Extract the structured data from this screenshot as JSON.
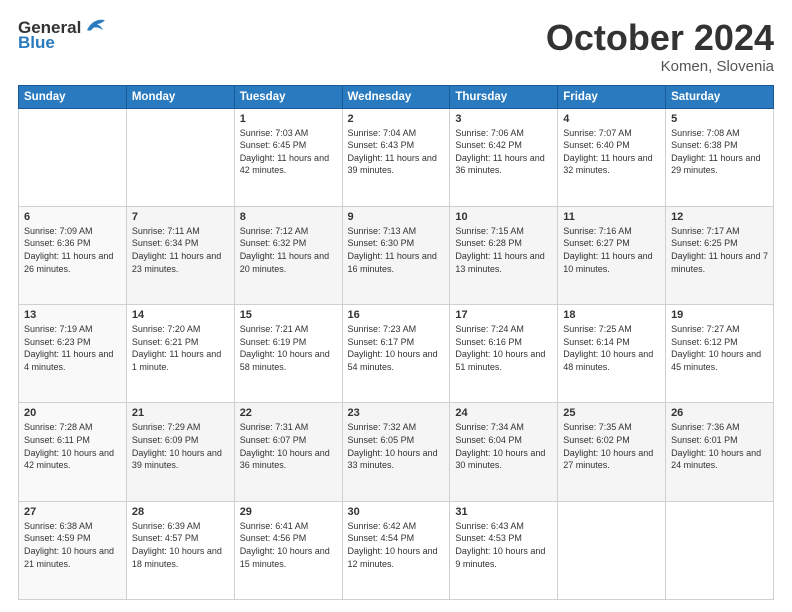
{
  "header": {
    "logo_text1": "General",
    "logo_text2": "Blue",
    "title": "October 2024",
    "location": "Komen, Slovenia"
  },
  "weekdays": [
    "Sunday",
    "Monday",
    "Tuesday",
    "Wednesday",
    "Thursday",
    "Friday",
    "Saturday"
  ],
  "weeks": [
    [
      {
        "day": "",
        "content": ""
      },
      {
        "day": "",
        "content": ""
      },
      {
        "day": "1",
        "content": "Sunrise: 7:03 AM\nSunset: 6:45 PM\nDaylight: 11 hours and 42 minutes."
      },
      {
        "day": "2",
        "content": "Sunrise: 7:04 AM\nSunset: 6:43 PM\nDaylight: 11 hours and 39 minutes."
      },
      {
        "day": "3",
        "content": "Sunrise: 7:06 AM\nSunset: 6:42 PM\nDaylight: 11 hours and 36 minutes."
      },
      {
        "day": "4",
        "content": "Sunrise: 7:07 AM\nSunset: 6:40 PM\nDaylight: 11 hours and 32 minutes."
      },
      {
        "day": "5",
        "content": "Sunrise: 7:08 AM\nSunset: 6:38 PM\nDaylight: 11 hours and 29 minutes."
      }
    ],
    [
      {
        "day": "6",
        "content": "Sunrise: 7:09 AM\nSunset: 6:36 PM\nDaylight: 11 hours and 26 minutes."
      },
      {
        "day": "7",
        "content": "Sunrise: 7:11 AM\nSunset: 6:34 PM\nDaylight: 11 hours and 23 minutes."
      },
      {
        "day": "8",
        "content": "Sunrise: 7:12 AM\nSunset: 6:32 PM\nDaylight: 11 hours and 20 minutes."
      },
      {
        "day": "9",
        "content": "Sunrise: 7:13 AM\nSunset: 6:30 PM\nDaylight: 11 hours and 16 minutes."
      },
      {
        "day": "10",
        "content": "Sunrise: 7:15 AM\nSunset: 6:28 PM\nDaylight: 11 hours and 13 minutes."
      },
      {
        "day": "11",
        "content": "Sunrise: 7:16 AM\nSunset: 6:27 PM\nDaylight: 11 hours and 10 minutes."
      },
      {
        "day": "12",
        "content": "Sunrise: 7:17 AM\nSunset: 6:25 PM\nDaylight: 11 hours and 7 minutes."
      }
    ],
    [
      {
        "day": "13",
        "content": "Sunrise: 7:19 AM\nSunset: 6:23 PM\nDaylight: 11 hours and 4 minutes."
      },
      {
        "day": "14",
        "content": "Sunrise: 7:20 AM\nSunset: 6:21 PM\nDaylight: 11 hours and 1 minute."
      },
      {
        "day": "15",
        "content": "Sunrise: 7:21 AM\nSunset: 6:19 PM\nDaylight: 10 hours and 58 minutes."
      },
      {
        "day": "16",
        "content": "Sunrise: 7:23 AM\nSunset: 6:17 PM\nDaylight: 10 hours and 54 minutes."
      },
      {
        "day": "17",
        "content": "Sunrise: 7:24 AM\nSunset: 6:16 PM\nDaylight: 10 hours and 51 minutes."
      },
      {
        "day": "18",
        "content": "Sunrise: 7:25 AM\nSunset: 6:14 PM\nDaylight: 10 hours and 48 minutes."
      },
      {
        "day": "19",
        "content": "Sunrise: 7:27 AM\nSunset: 6:12 PM\nDaylight: 10 hours and 45 minutes."
      }
    ],
    [
      {
        "day": "20",
        "content": "Sunrise: 7:28 AM\nSunset: 6:11 PM\nDaylight: 10 hours and 42 minutes."
      },
      {
        "day": "21",
        "content": "Sunrise: 7:29 AM\nSunset: 6:09 PM\nDaylight: 10 hours and 39 minutes."
      },
      {
        "day": "22",
        "content": "Sunrise: 7:31 AM\nSunset: 6:07 PM\nDaylight: 10 hours and 36 minutes."
      },
      {
        "day": "23",
        "content": "Sunrise: 7:32 AM\nSunset: 6:05 PM\nDaylight: 10 hours and 33 minutes."
      },
      {
        "day": "24",
        "content": "Sunrise: 7:34 AM\nSunset: 6:04 PM\nDaylight: 10 hours and 30 minutes."
      },
      {
        "day": "25",
        "content": "Sunrise: 7:35 AM\nSunset: 6:02 PM\nDaylight: 10 hours and 27 minutes."
      },
      {
        "day": "26",
        "content": "Sunrise: 7:36 AM\nSunset: 6:01 PM\nDaylight: 10 hours and 24 minutes."
      }
    ],
    [
      {
        "day": "27",
        "content": "Sunrise: 6:38 AM\nSunset: 4:59 PM\nDaylight: 10 hours and 21 minutes."
      },
      {
        "day": "28",
        "content": "Sunrise: 6:39 AM\nSunset: 4:57 PM\nDaylight: 10 hours and 18 minutes."
      },
      {
        "day": "29",
        "content": "Sunrise: 6:41 AM\nSunset: 4:56 PM\nDaylight: 10 hours and 15 minutes."
      },
      {
        "day": "30",
        "content": "Sunrise: 6:42 AM\nSunset: 4:54 PM\nDaylight: 10 hours and 12 minutes."
      },
      {
        "day": "31",
        "content": "Sunrise: 6:43 AM\nSunset: 4:53 PM\nDaylight: 10 hours and 9 minutes."
      },
      {
        "day": "",
        "content": ""
      },
      {
        "day": "",
        "content": ""
      }
    ]
  ]
}
